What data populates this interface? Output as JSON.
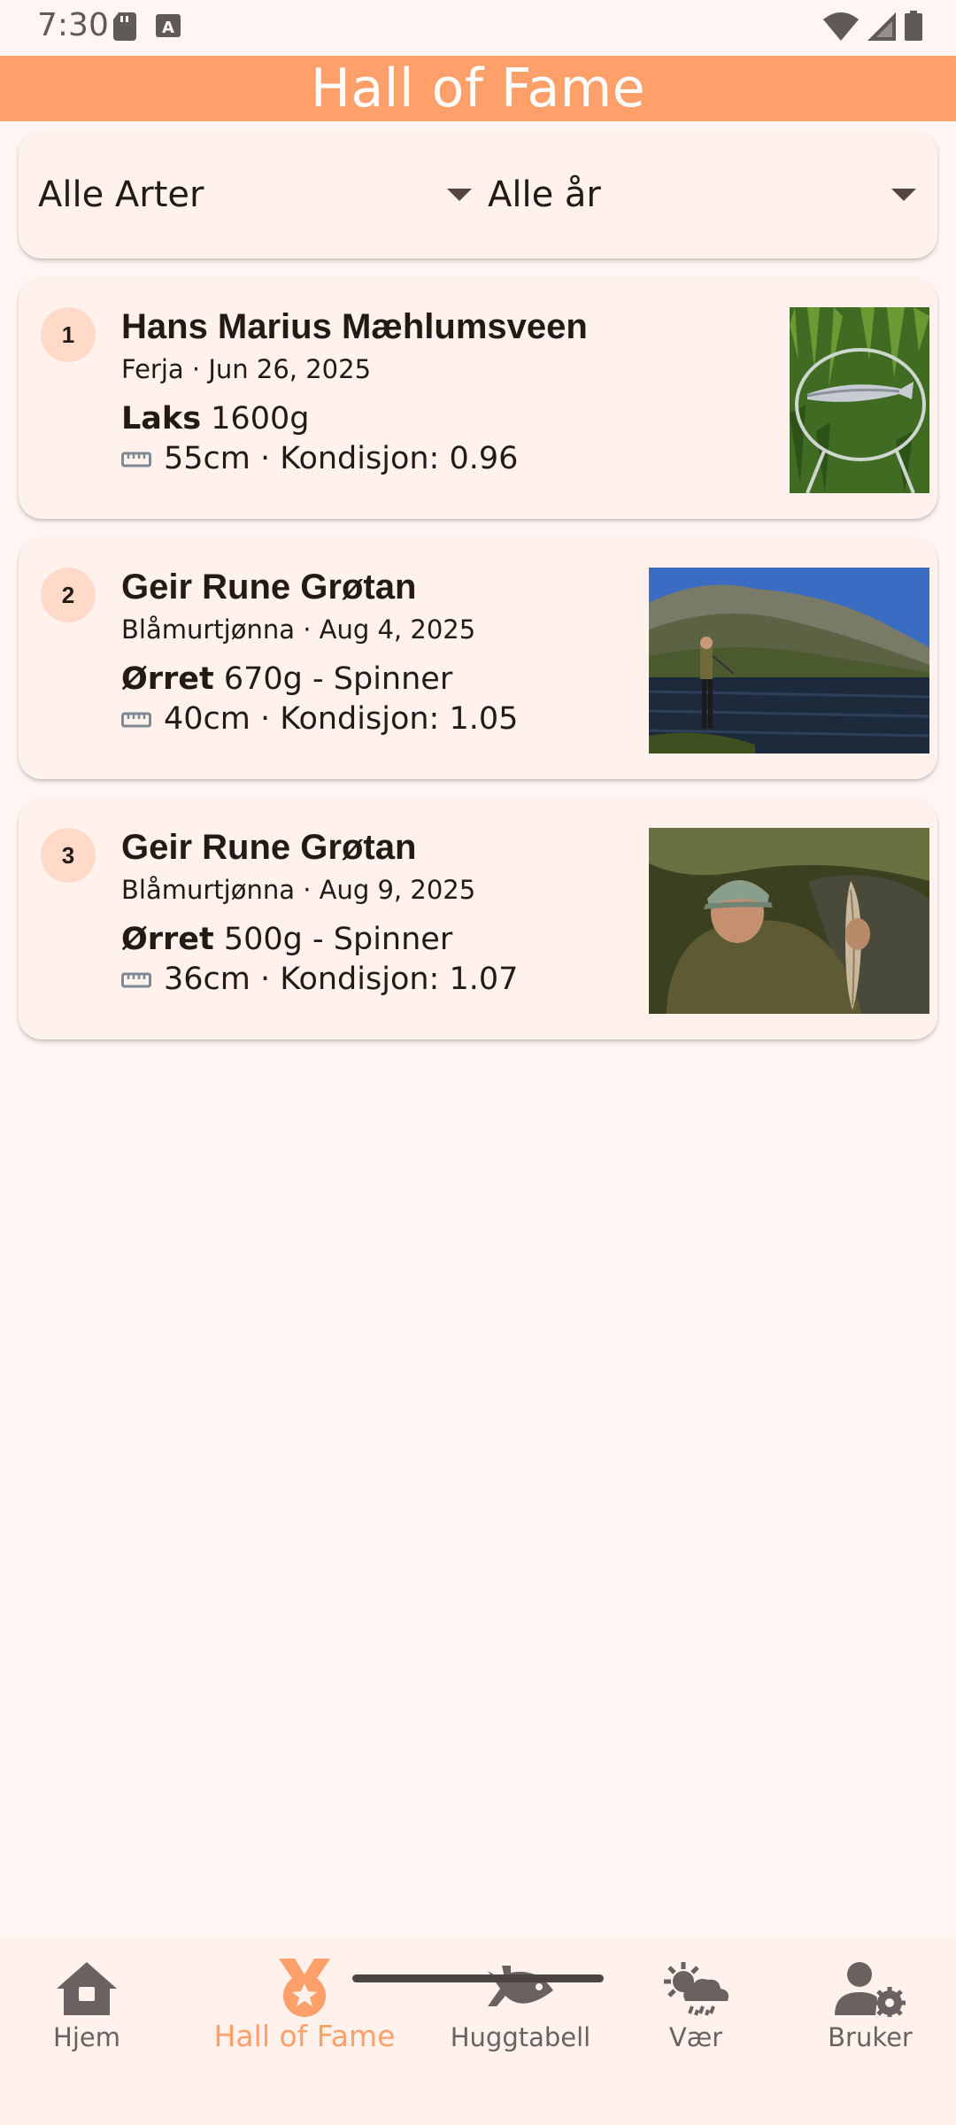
{
  "status_bar": {
    "time": "7:30"
  },
  "app_bar": {
    "title": "Hall of Fame"
  },
  "filters": {
    "species": {
      "selected": "Alle Arter"
    },
    "year": {
      "selected": "Alle år"
    }
  },
  "entries": [
    {
      "rank": "1",
      "name": "Hans Marius Mæhlumsveen",
      "location": "Ferja",
      "date": "Jun 26, 2025",
      "species": "Laks",
      "weight_detail": " 1600g",
      "size_detail": "55cm · Kondisjon: 0.96"
    },
    {
      "rank": "2",
      "name": "Geir Rune Grøtan",
      "location": "Blåmurtjønna",
      "date": "Aug 4, 2025",
      "species": "Ørret",
      "weight_detail": " 670g - Spinner",
      "size_detail": "40cm · Kondisjon: 1.05"
    },
    {
      "rank": "3",
      "name": "Geir Rune Grøtan",
      "location": "Blåmurtjønna",
      "date": "Aug 9, 2025",
      "species": "Ørret",
      "weight_detail": " 500g - Spinner",
      "size_detail": "36cm · Kondisjon: 1.07"
    }
  ],
  "bottom_nav": {
    "items": [
      {
        "label": "Hjem",
        "icon": "home-icon"
      },
      {
        "label": "Hall of Fame",
        "icon": "medal-icon",
        "active": true
      },
      {
        "label": "Huggtabell",
        "icon": "fish-icon"
      },
      {
        "label": "Vær",
        "icon": "weather-icon"
      },
      {
        "label": "Bruker",
        "icon": "user-settings-icon"
      }
    ]
  },
  "colors": {
    "accent": "#ff9f6a",
    "background": "#fff5f2",
    "card": "#fff1ec",
    "badge": "#ffdac8",
    "nav_inactive": "#6a6160"
  }
}
